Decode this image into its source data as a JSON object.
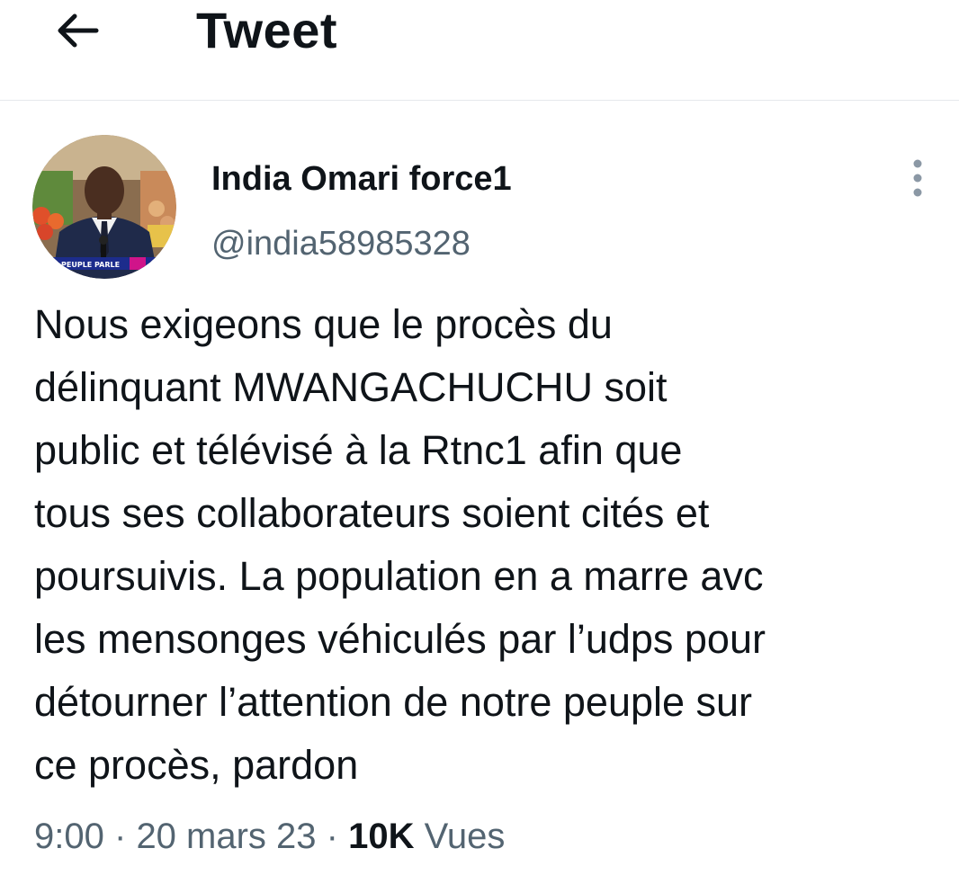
{
  "header": {
    "back_icon": "arrow-left-icon",
    "title": "Tweet"
  },
  "tweet": {
    "author": {
      "display_name": "India Omari force1",
      "handle": "@india58985328",
      "avatar_caption": "PEUPLE PARLE"
    },
    "more_icon": "more-vertical-icon",
    "text_lines": [
      "Nous exigeons que le procès du",
      "délinquant MWANGACHUCHU soit",
      "public et télévisé à la Rtnc1 afin que",
      "tous ses collaborateurs soient cités et",
      "poursuivis. La population en a marre avc",
      "les mensonges véhiculés par l’udps pour",
      "détourner l’attention de notre peuple sur",
      "ce procès, pardon"
    ],
    "meta": {
      "time": "9:00",
      "separator": "·",
      "date": "20 mars 23",
      "views_count": "10K",
      "views_label": "Vues"
    }
  },
  "colors": {
    "text_primary": "#0f1419",
    "text_secondary": "#536471",
    "divider": "#e6e9ec"
  }
}
